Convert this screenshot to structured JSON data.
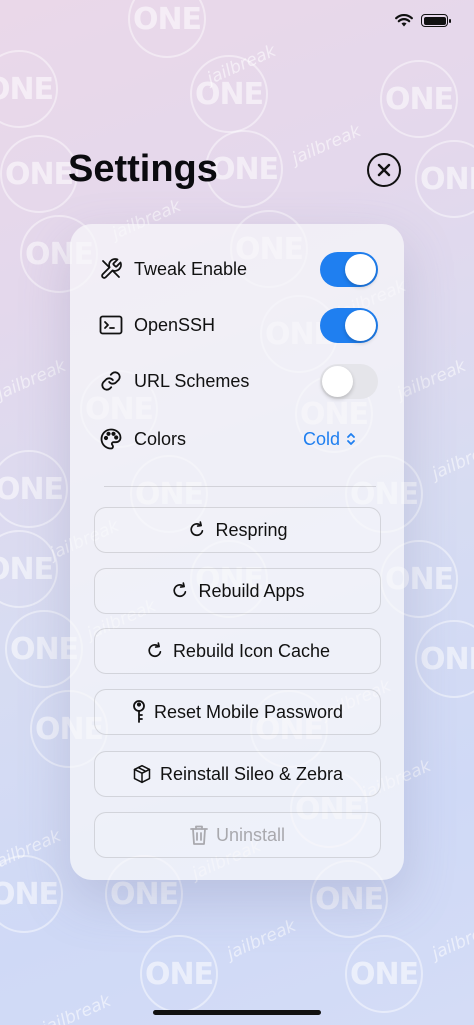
{
  "watermark": {
    "logo": "ONE",
    "sub": "jailbreak"
  },
  "header": {
    "title": "Settings"
  },
  "settings": [
    {
      "label": "Tweak Enable",
      "icon": "tools-icon",
      "type": "toggle",
      "on": true
    },
    {
      "label": "OpenSSH",
      "icon": "terminal-icon",
      "type": "toggle",
      "on": true
    },
    {
      "label": "URL Schemes",
      "icon": "link-icon",
      "type": "toggle",
      "on": false
    },
    {
      "label": "Colors",
      "icon": "palette-icon",
      "type": "select",
      "value": "Cold"
    }
  ],
  "actions": [
    {
      "label": "Respring",
      "icon": "refresh-icon"
    },
    {
      "label": "Rebuild Apps",
      "icon": "refresh-icon"
    },
    {
      "label": "Rebuild Icon Cache",
      "icon": "refresh-icon"
    },
    {
      "label": "Reset Mobile Password",
      "icon": "key-icon"
    },
    {
      "label": "Reinstall Sileo & Zebra",
      "icon": "package-icon"
    },
    {
      "label": "Uninstall",
      "icon": "trash-icon",
      "disabled": true
    }
  ],
  "colors": {
    "accent": "#1f7ff0",
    "toggle_off": "#e5e5ea",
    "disabled": "#a9a9ae"
  }
}
